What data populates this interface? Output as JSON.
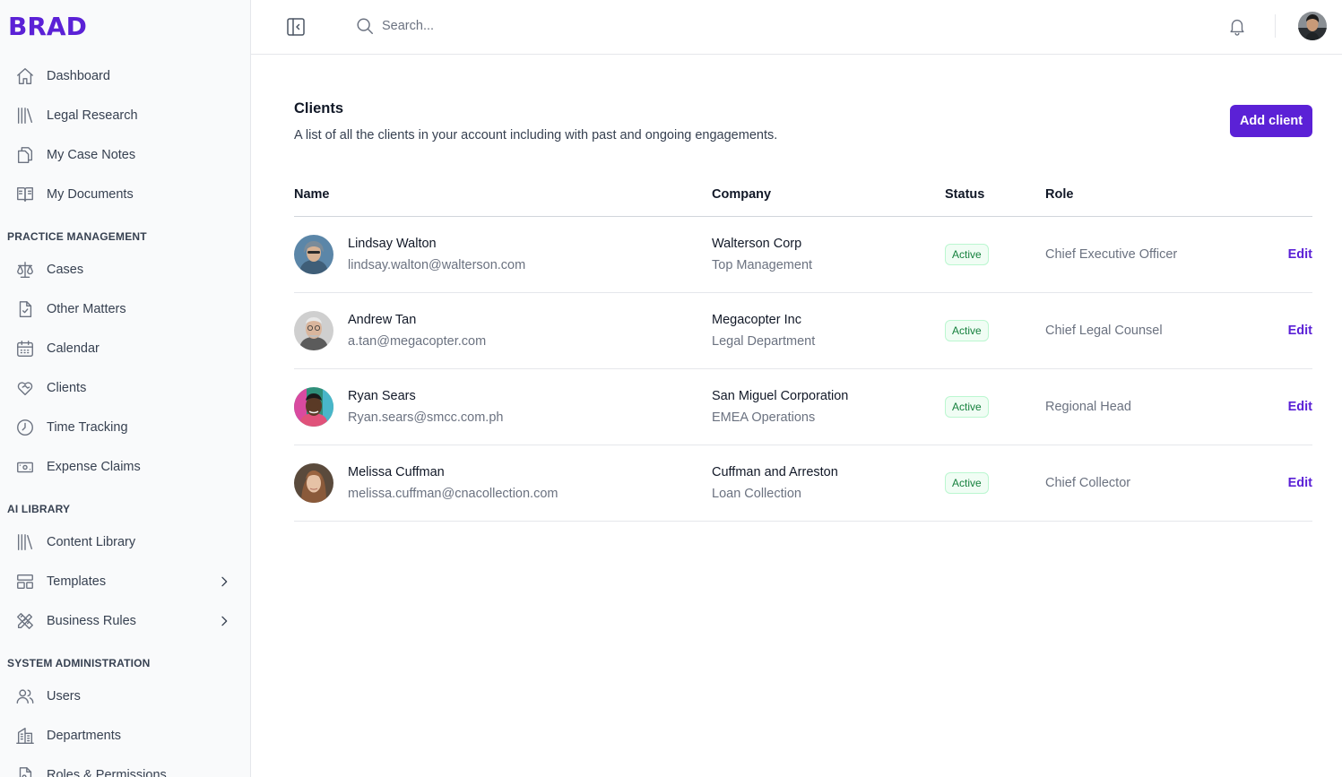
{
  "brand": {
    "logo": "BRAD",
    "accent": "#5b21d6"
  },
  "sidebar": {
    "items": [
      {
        "label": "Dashboard",
        "icon": "home-icon"
      },
      {
        "label": "Legal Research",
        "icon": "library-icon"
      },
      {
        "label": "My Case Notes",
        "icon": "document-duplicate-icon"
      },
      {
        "label": "My Documents",
        "icon": "book-open-icon"
      }
    ],
    "practice_section": "PRACTICE MANAGEMENT",
    "practice_items": [
      {
        "label": "Cases",
        "icon": "scale-icon"
      },
      {
        "label": "Other Matters",
        "icon": "document-check-icon"
      },
      {
        "label": "Calendar",
        "icon": "calendar-icon"
      },
      {
        "label": "Clients",
        "icon": "heart-handshake-icon"
      },
      {
        "label": "Time Tracking",
        "icon": "clock-icon"
      },
      {
        "label": "Expense Claims",
        "icon": "banknote-icon"
      }
    ],
    "ai_section": "AI LIBRARY",
    "ai_items": [
      {
        "label": "Content Library",
        "icon": "library-icon"
      },
      {
        "label": "Templates",
        "icon": "layout-icon"
      },
      {
        "label": "Business Rules",
        "icon": "pencil-ruler-icon"
      }
    ],
    "admin_section": "SYSTEM ADMINISTRATION",
    "admin_items": [
      {
        "label": "Users",
        "icon": "users-icon"
      },
      {
        "label": "Departments",
        "icon": "building-icon"
      },
      {
        "label": "Roles & Permissions",
        "icon": "document-key-icon"
      }
    ]
  },
  "topbar": {
    "search_placeholder": "Search..."
  },
  "main": {
    "title": "Clients",
    "description": "A list of all the clients in your account including with past and ongoing engagements.",
    "add_button": "Add client",
    "columns": [
      "Name",
      "Company",
      "Status",
      "Role"
    ],
    "rows": [
      {
        "name": "Lindsay Walton",
        "email": "lindsay.walton@walterson.com",
        "company": "Walterson Corp",
        "department": "Top Management",
        "status": "Active",
        "role": "Chief Executive Officer",
        "action": "Edit"
      },
      {
        "name": "Andrew Tan",
        "email": "a.tan@megacopter.com",
        "company": "Megacopter Inc",
        "department": "Legal Department",
        "status": "Active",
        "role": "Chief Legal Counsel",
        "action": "Edit"
      },
      {
        "name": "Ryan Sears",
        "email": "Ryan.sears@smcc.com.ph",
        "company": "San Miguel Corporation",
        "department": "EMEA Operations",
        "status": "Active",
        "role": "Regional Head",
        "action": "Edit"
      },
      {
        "name": "Melissa Cuffman",
        "email": "melissa.cuffman@cnacollection.com",
        "company": "Cuffman and Arreston",
        "department": "Loan Collection",
        "status": "Active",
        "role": "Chief Collector",
        "action": "Edit"
      }
    ]
  }
}
